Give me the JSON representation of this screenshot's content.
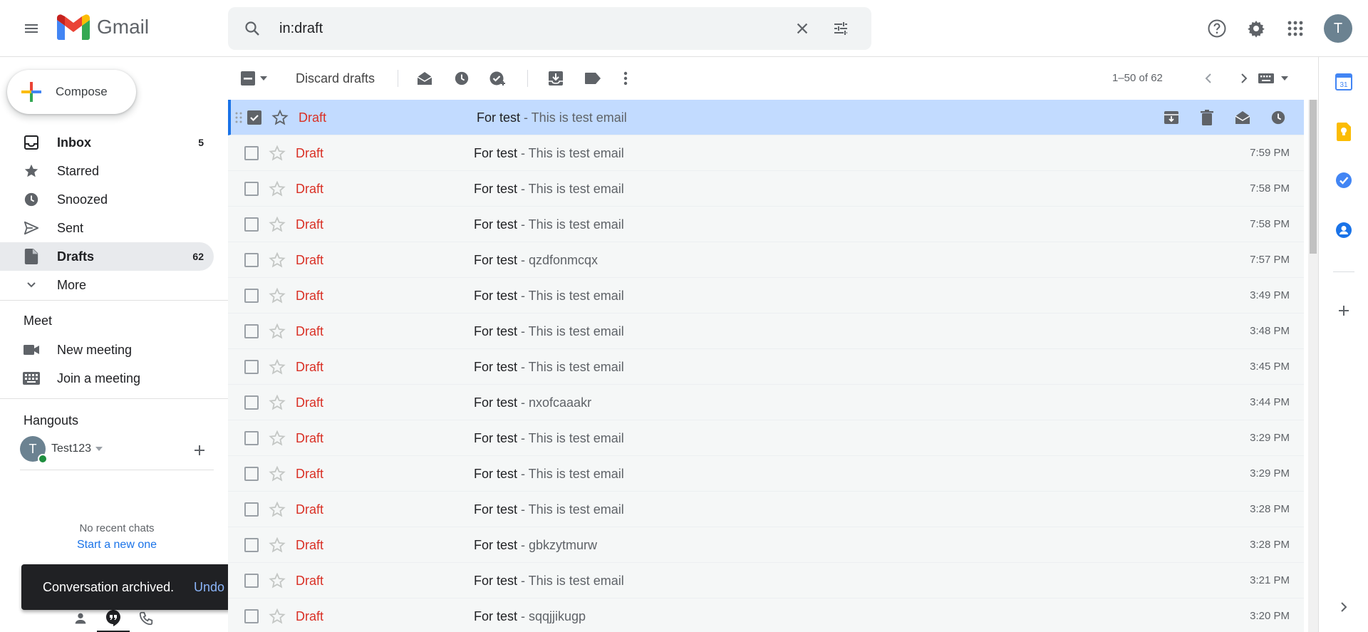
{
  "header": {
    "app_name": "Gmail",
    "search_value": "in:draft",
    "avatar_letter": "T"
  },
  "nav": {
    "compose_label": "Compose",
    "items": [
      {
        "label": "Inbox",
        "count": "5",
        "icon": "inbox-icon"
      },
      {
        "label": "Starred",
        "count": "",
        "icon": "star-icon"
      },
      {
        "label": "Snoozed",
        "count": "",
        "icon": "clock-icon"
      },
      {
        "label": "Sent",
        "count": "",
        "icon": "send-icon"
      },
      {
        "label": "Drafts",
        "count": "62",
        "icon": "draft-icon"
      },
      {
        "label": "More",
        "count": "",
        "icon": "chevron-down-icon"
      }
    ],
    "meet": {
      "title": "Meet",
      "new_meeting": "New meeting",
      "join_meeting": "Join a meeting"
    },
    "hangouts": {
      "title": "Hangouts",
      "user_letter": "T",
      "user_name": "Test123",
      "no_chats": "No recent chats",
      "start_new": "Start a new one"
    }
  },
  "toast": {
    "message": "Conversation archived.",
    "undo": "Undo"
  },
  "toolbar": {
    "discard_label": "Discard drafts",
    "pager": "1–50 of 62"
  },
  "mails": [
    {
      "sender": "Draft",
      "subject": "For test",
      "snippet": " - This is test email",
      "time": ""
    },
    {
      "sender": "Draft",
      "subject": "For test",
      "snippet": " - This is test email",
      "time": "7:59 PM"
    },
    {
      "sender": "Draft",
      "subject": "For test",
      "snippet": " - This is test email",
      "time": "7:58 PM"
    },
    {
      "sender": "Draft",
      "subject": "For test",
      "snippet": " - This is test email",
      "time": "7:58 PM"
    },
    {
      "sender": "Draft",
      "subject": "For test",
      "snippet": " - qzdfonmcqx",
      "time": "7:57 PM"
    },
    {
      "sender": "Draft",
      "subject": "For test",
      "snippet": " - This is test email",
      "time": "3:49 PM"
    },
    {
      "sender": "Draft",
      "subject": "For test",
      "snippet": " - This is test email",
      "time": "3:48 PM"
    },
    {
      "sender": "Draft",
      "subject": "For test",
      "snippet": " - This is test email",
      "time": "3:45 PM"
    },
    {
      "sender": "Draft",
      "subject": "For test",
      "snippet": " - nxofcaaakr",
      "time": "3:44 PM"
    },
    {
      "sender": "Draft",
      "subject": "For test",
      "snippet": " - This is test email",
      "time": "3:29 PM"
    },
    {
      "sender": "Draft",
      "subject": "For test",
      "snippet": " - This is test email",
      "time": "3:29 PM"
    },
    {
      "sender": "Draft",
      "subject": "For test",
      "snippet": " - This is test email",
      "time": "3:28 PM"
    },
    {
      "sender": "Draft",
      "subject": "For test",
      "snippet": " - gbkzytmurw",
      "time": "3:28 PM"
    },
    {
      "sender": "Draft",
      "subject": "For test",
      "snippet": " - This is test email",
      "time": "3:21 PM"
    },
    {
      "sender": "Draft",
      "subject": "For test",
      "snippet": " - sqqjjikugp",
      "time": "3:20 PM"
    }
  ],
  "side_panel": {
    "calendar_day": "31"
  },
  "colors": {
    "accent": "#1a73e8",
    "draft_red": "#d93025",
    "selected_row": "#c2dbff",
    "toast_bg": "#202124"
  }
}
